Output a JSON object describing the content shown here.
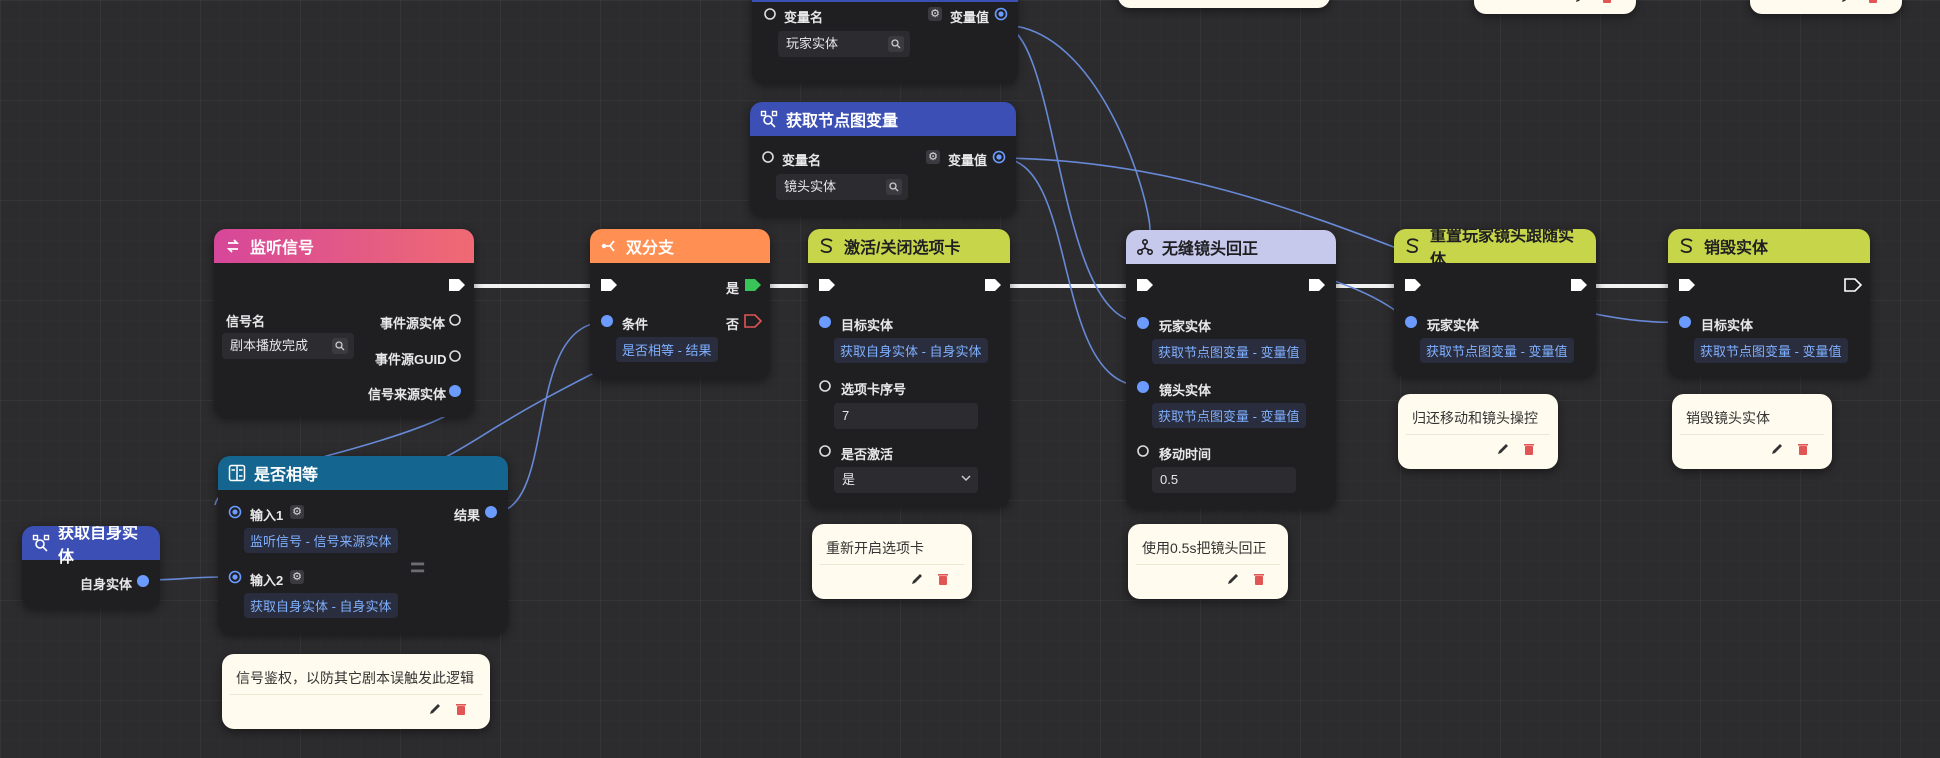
{
  "colors": {
    "blue_header": "#3b4fb5",
    "pink_header": "#e0508a",
    "orange_header": "#ff8f52",
    "lime_header": "#c7d54a",
    "lavender_header": "#c7c9ec",
    "teal_header": "#14658f",
    "pin_blue": "#6b9bff",
    "pin_green": "#39c45a",
    "pin_red": "#e25555"
  },
  "nodes": {
    "get_var_top": {
      "var_name_label": "变量名",
      "var_value_label": "变量值",
      "var_name_value": "玩家实体"
    },
    "get_var_camera": {
      "title": "获取节点图变量",
      "var_name_label": "变量名",
      "var_value_label": "变量值",
      "var_name_value": "镜头实体"
    },
    "listen_signal": {
      "title": "监听信号",
      "signal_name_label": "信号名",
      "signal_name_value": "剧本播放完成",
      "out_event_entity": "事件源实体",
      "out_event_guid": "事件源GUID",
      "out_signal_entity": "信号来源实体"
    },
    "branch": {
      "title": "双分支",
      "yes_label": "是",
      "no_label": "否",
      "cond_label": "条件",
      "cond_value": "是否相等 - 结果"
    },
    "toggle_tab": {
      "title": "激活/关闭选项卡",
      "target_label": "目标实体",
      "target_value": "获取自身实体 - 自身实体",
      "tab_index_label": "选项卡序号",
      "tab_index_value": "7",
      "active_label": "是否激活",
      "active_value": "是"
    },
    "camera_reset": {
      "title": "无缝镜头回正",
      "player_label": "玩家实体",
      "player_value": "获取节点图变量 - 变量值",
      "camera_label": "镜头实体",
      "camera_value": "获取节点图变量 - 变量值",
      "move_time_label": "移动时间",
      "move_time_value": "0.5"
    },
    "reset_follow": {
      "title": "重置玩家镜头跟随实体",
      "player_label": "玩家实体",
      "player_value": "获取节点图变量 - 变量值"
    },
    "destroy": {
      "title": "销毁实体",
      "target_label": "目标实体",
      "target_value": "获取节点图变量 - 变量值"
    },
    "equals": {
      "title": "是否相等",
      "input1_label": "输入1",
      "input1_value": "监听信号 - 信号来源实体",
      "input2_label": "输入2",
      "input2_value": "获取自身实体 - 自身实体",
      "result_label": "结果",
      "op_symbol": "="
    },
    "get_self": {
      "title": "获取自身实体",
      "out_label": "自身实体"
    }
  },
  "notes": {
    "reopen_tab": "重新开启选项卡",
    "camera_reset": "使用0.5s把镜头回正",
    "restore_move": "归还移动和镜头操控",
    "destroy_camera": "销毁镜头实体",
    "signal_auth": "信号鉴权，以防其它剧本误触发此逻辑"
  }
}
